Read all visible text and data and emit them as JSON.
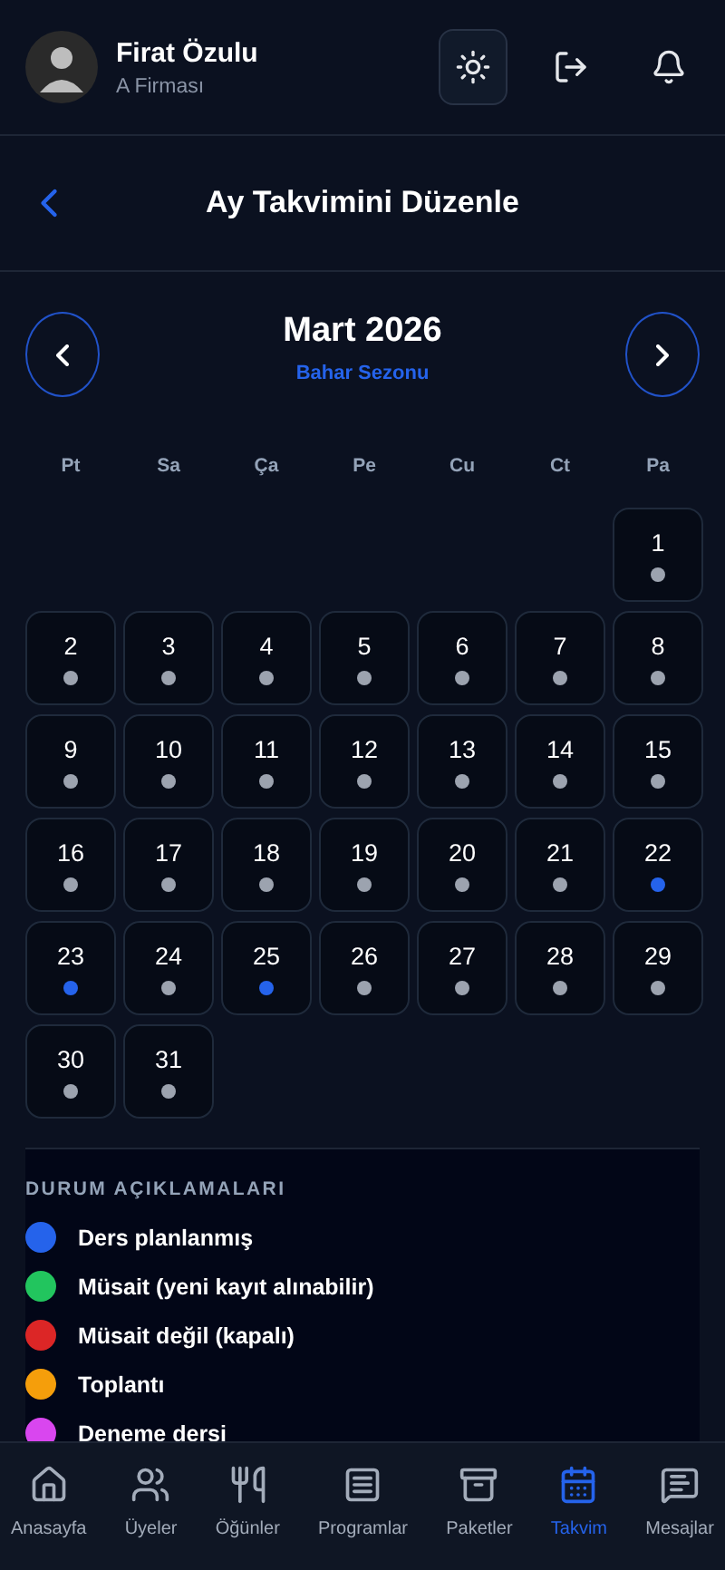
{
  "user": {
    "name": "Firat Özulu",
    "company": "A Firması"
  },
  "page_title": "Ay Takvimini Düzenle",
  "month": {
    "title": "Mart 2026",
    "season": "Bahar Sezonu"
  },
  "weekdays": [
    "Pt",
    "Sa",
    "Ça",
    "Pe",
    "Cu",
    "Ct",
    "Pa"
  ],
  "days": [
    {
      "label": "1",
      "color": "#9ca3af"
    },
    {
      "label": "2",
      "color": "#9ca3af"
    },
    {
      "label": "3",
      "color": "#9ca3af"
    },
    {
      "label": "4",
      "color": "#9ca3af"
    },
    {
      "label": "5",
      "color": "#9ca3af"
    },
    {
      "label": "6",
      "color": "#9ca3af"
    },
    {
      "label": "7",
      "color": "#9ca3af"
    },
    {
      "label": "8",
      "color": "#9ca3af"
    },
    {
      "label": "9",
      "color": "#9ca3af"
    },
    {
      "label": "10",
      "color": "#9ca3af"
    },
    {
      "label": "11",
      "color": "#9ca3af"
    },
    {
      "label": "12",
      "color": "#9ca3af"
    },
    {
      "label": "13",
      "color": "#9ca3af"
    },
    {
      "label": "14",
      "color": "#9ca3af"
    },
    {
      "label": "15",
      "color": "#9ca3af"
    },
    {
      "label": "16",
      "color": "#9ca3af"
    },
    {
      "label": "17",
      "color": "#9ca3af"
    },
    {
      "label": "18",
      "color": "#9ca3af"
    },
    {
      "label": "19",
      "color": "#9ca3af"
    },
    {
      "label": "20",
      "color": "#9ca3af"
    },
    {
      "label": "21",
      "color": "#9ca3af"
    },
    {
      "label": "22",
      "color": "#2563eb"
    },
    {
      "label": "23",
      "color": "#2563eb"
    },
    {
      "label": "24",
      "color": "#9ca3af"
    },
    {
      "label": "25",
      "color": "#2563eb"
    },
    {
      "label": "26",
      "color": "#9ca3af"
    },
    {
      "label": "27",
      "color": "#9ca3af"
    },
    {
      "label": "28",
      "color": "#9ca3af"
    },
    {
      "label": "29",
      "color": "#9ca3af"
    },
    {
      "label": "30",
      "color": "#9ca3af"
    },
    {
      "label": "31",
      "color": "#9ca3af"
    }
  ],
  "legend": {
    "title": "DURUM AÇIKLAMALARI",
    "items": [
      {
        "label": "Ders planlanmış",
        "color": "#2563eb"
      },
      {
        "label": "Müsait (yeni kayıt alınabilir)",
        "color": "#22c55e"
      },
      {
        "label": "Müsait değil (kapalı)",
        "color": "#dc2626"
      },
      {
        "label": "Toplantı",
        "color": "#f59e0b"
      },
      {
        "label": "Deneme dersi",
        "color": "#d946ef"
      }
    ]
  },
  "nav": [
    {
      "label": "Anasayfa",
      "selected": false
    },
    {
      "label": "Üyeler",
      "selected": false
    },
    {
      "label": "Öğünler",
      "selected": false
    },
    {
      "label": "Programlar",
      "selected": false
    },
    {
      "label": "Paketler",
      "selected": false
    },
    {
      "label": "Takvim",
      "selected": true
    },
    {
      "label": "Mesajlar",
      "selected": false
    }
  ]
}
